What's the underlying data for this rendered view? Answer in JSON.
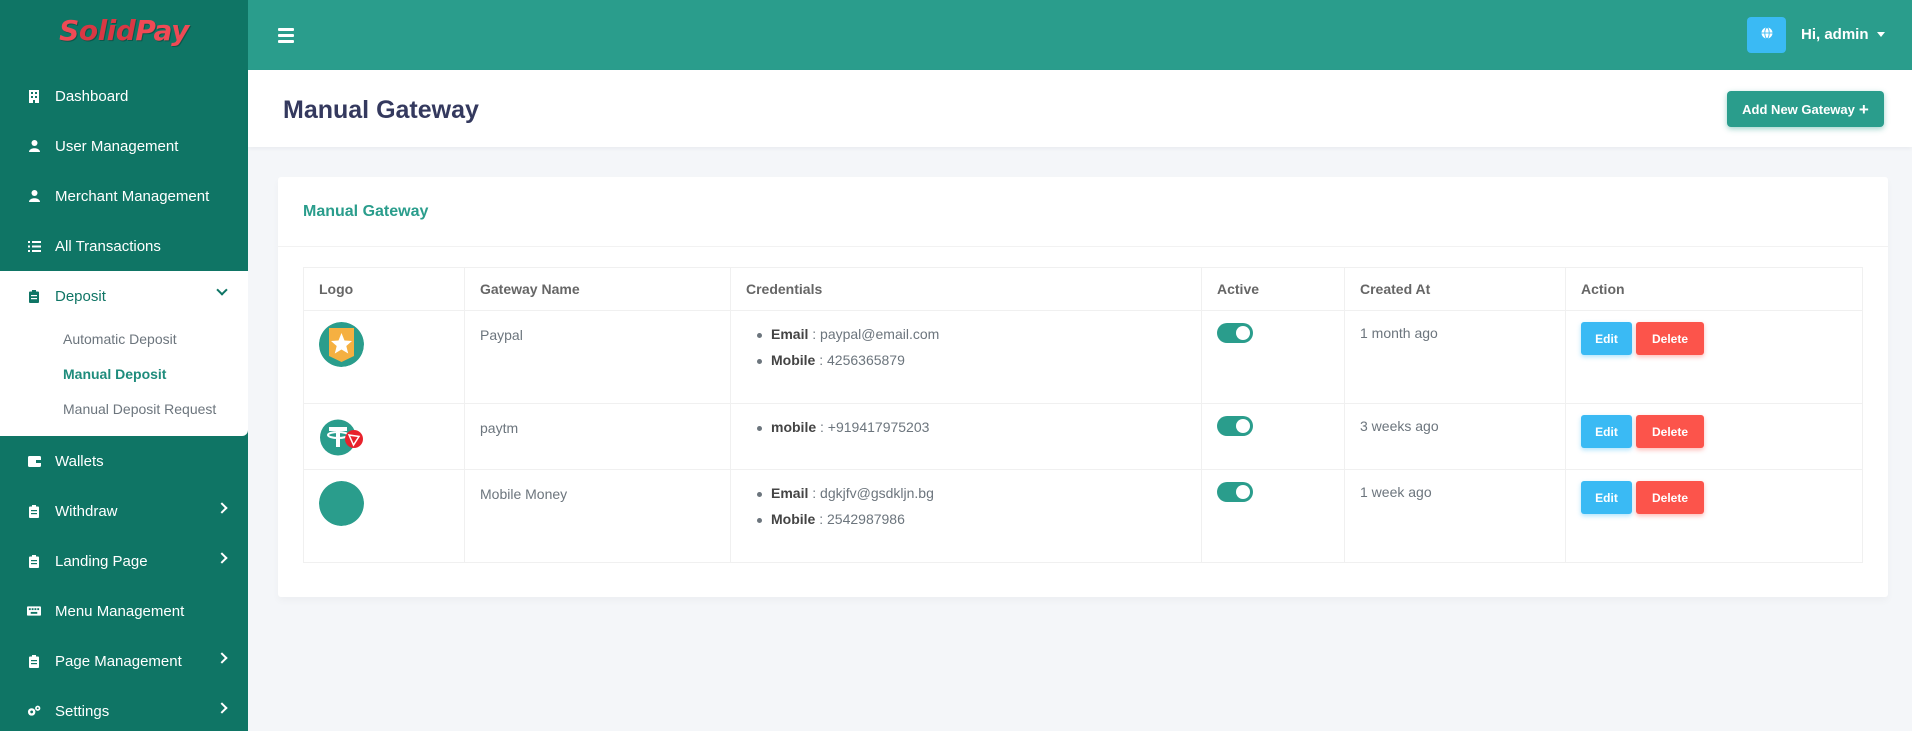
{
  "brand": {
    "part1": "S",
    "part2": "olid",
    "part3": "Pay"
  },
  "sidebar": {
    "items": [
      {
        "label": "Dashboard",
        "icon": "building-icon"
      },
      {
        "label": "User Management",
        "icon": "user-icon"
      },
      {
        "label": "Merchant Management",
        "icon": "user-icon"
      },
      {
        "label": "All Transactions",
        "icon": "list-icon"
      },
      {
        "label": "Deposit",
        "icon": "clipboard-icon",
        "expanded": true,
        "children": [
          {
            "label": "Automatic Deposit"
          },
          {
            "label": "Manual Deposit",
            "active": true
          },
          {
            "label": "Manual Deposit Request"
          }
        ]
      },
      {
        "label": "Wallets",
        "icon": "wallet-icon"
      },
      {
        "label": "Withdraw",
        "icon": "clipboard-icon"
      },
      {
        "label": "Landing Page",
        "icon": "clipboard-icon"
      },
      {
        "label": "Menu Management",
        "icon": "keyboard-icon"
      },
      {
        "label": "Page Management",
        "icon": "clipboard-icon"
      },
      {
        "label": "Settings",
        "icon": "cogs-icon"
      }
    ]
  },
  "topbar": {
    "user_greeting": "Hi, admin"
  },
  "page": {
    "title": "Manual Gateway",
    "add_button": "Add New Gateway",
    "add_icon": "+"
  },
  "card": {
    "title": "Manual Gateway"
  },
  "table": {
    "headers": [
      "Logo",
      "Gateway Name",
      "Credentials",
      "Active",
      "Created At",
      "Action"
    ],
    "rows": [
      {
        "name": "Paypal",
        "logo": "star-badge-logo",
        "credentials": [
          {
            "key": "Email",
            "value": "paypal@email.com"
          },
          {
            "key": "Mobile",
            "value": "4256365879"
          }
        ],
        "active": true,
        "created": "1 month ago"
      },
      {
        "name": "paytm",
        "logo": "tether-tron-logo",
        "credentials": [
          {
            "key": "mobile",
            "value": "+919417975203"
          }
        ],
        "active": true,
        "created": "3 weeks ago"
      },
      {
        "name": "Mobile Money",
        "logo": "teal-circle-logo",
        "credentials": [
          {
            "key": "Email",
            "value": "dgkjfv@gsdkljn.bg"
          },
          {
            "key": "Mobile",
            "value": "2542987986"
          }
        ],
        "active": true,
        "created": "1 week ago"
      }
    ],
    "edit_label": "Edit",
    "delete_label": "Delete",
    "separator": " : "
  },
  "colors": {
    "sidebar": "#0f7565",
    "primary": "#2a9d8c",
    "info": "#3abaf4",
    "danger": "#fc544b"
  }
}
